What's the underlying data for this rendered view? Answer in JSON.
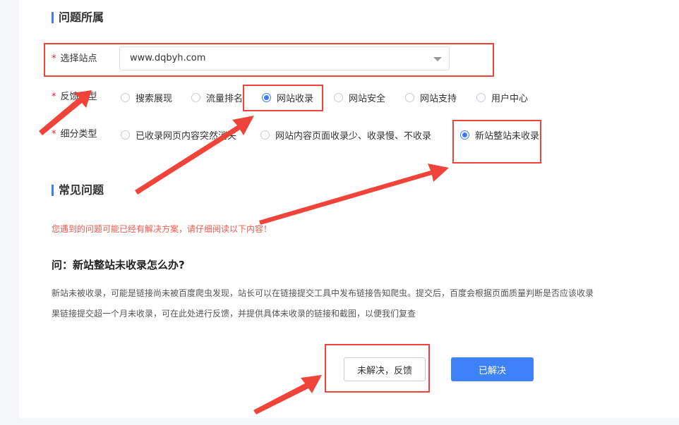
{
  "section1": {
    "title": "问题所属"
  },
  "site": {
    "label": "选择站点",
    "value": "www.dqbyh.com"
  },
  "feedback_type": {
    "label": "反馈类型",
    "options": [
      "搜索展现",
      "流量排名",
      "网站收录",
      "网站安全",
      "网站支持",
      "用户中心"
    ],
    "selected": "网站收录"
  },
  "sub_type": {
    "label": "细分类型",
    "options": [
      "已收录网页内容突然消失",
      "网站内容页面收录少、收录慢、不收录",
      "新站整站未收录"
    ],
    "selected": "新站整站未收录"
  },
  "section2": {
    "title": "常见问题"
  },
  "notice": "您遇到的问题可能已经有解决方案，请仔细阅读以下内容！",
  "faq": {
    "question": "问：新站整站未收录怎么办?",
    "answer_line1": "新站未被收录，可能是链接尚未被百度爬虫发现，站长可以在链接提交工具中发布链接告知爬虫。提交后，百度会根据页面质量判断是否应该收录",
    "answer_line2": "果链接提交超一个月未收录，可在此处进行反馈，并提供具体未收录的链接和截图，以便我们复查"
  },
  "buttons": {
    "unresolved": "未解决，反馈",
    "resolved": "已解决"
  },
  "colors": {
    "accent": "#3b7cff",
    "annotation": "#f0443a",
    "notice": "#f05a50"
  }
}
